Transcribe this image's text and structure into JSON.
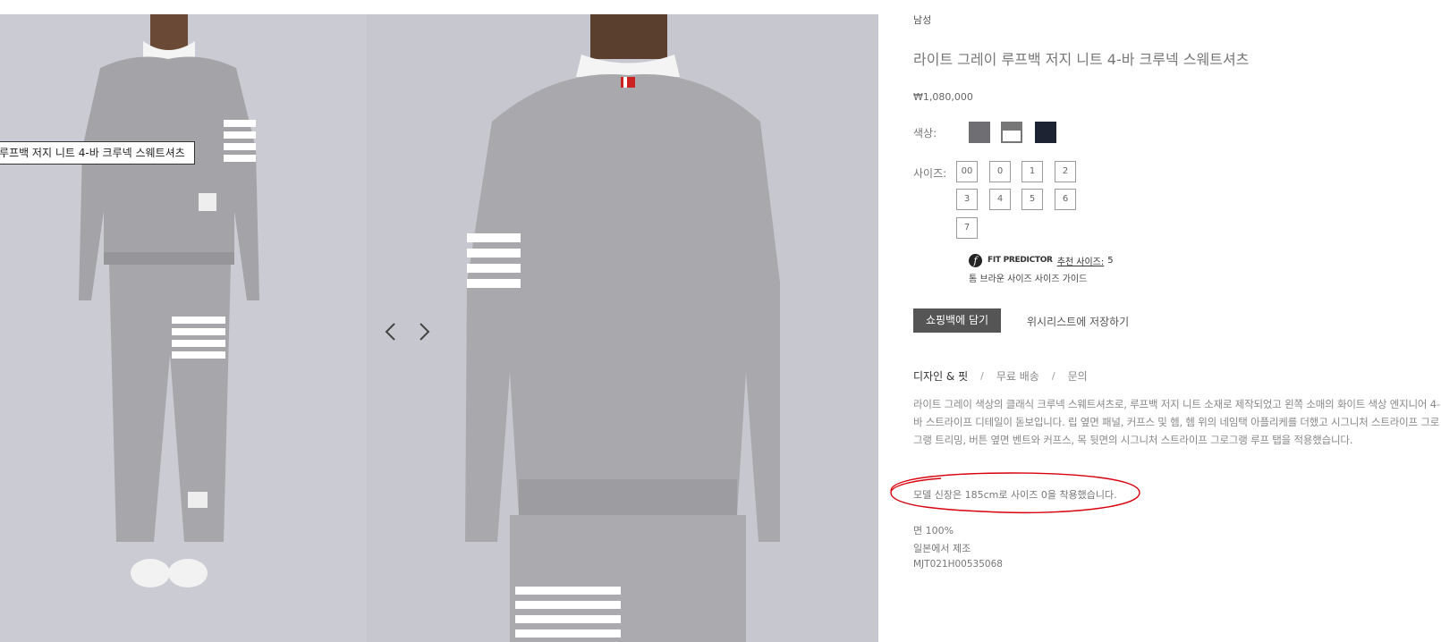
{
  "gallery": {
    "tooltip": "루프백 저지 니트 4-바 크루넥 스웨트셔츠",
    "prev_arrow": "chevron-left-icon",
    "next_arrow": "chevron-right-icon"
  },
  "product": {
    "gender": "남성",
    "title": "라이트 그레이 루프백 저지 니트 4-바 크루넥 스웨트셔츠",
    "price": "₩1,080,000",
    "color_label": "색상:",
    "colors": [
      {
        "name": "medium-grey",
        "hex": "#6f6f73"
      },
      {
        "name": "light-grey",
        "hex": "#777777"
      },
      {
        "name": "navy",
        "hex": "#1d2333"
      }
    ],
    "size_label": "사이즈:",
    "sizes": [
      "00",
      "0",
      "1",
      "2",
      "3",
      "4",
      "5",
      "6",
      "7"
    ],
    "fit_predictor": {
      "brand": "FIT PREDICTOR",
      "link_text": "추천 사이즈:",
      "value": "5"
    },
    "size_guide": "톰 브라운 사이즈 사이즈 가이드",
    "add_to_bag": "쇼핑백에 담기",
    "wishlist": "위시리스트에 저장하기",
    "tabs": [
      "디자인 & 핏",
      "무료 배송",
      "문의"
    ],
    "tab_separator": "/",
    "description": "라이트 그레이 색상의 클래식 크루넥 스웨트셔츠로, 루프백 저지 니트 소재로 제작되었고 왼쪽 소매의 화이트 색상 엔지니어 4-바 스트라이프 디테일이 돋보입니다. 립 옆면 패널, 커프스 및 헴, 헴 위의 네임택 아플리케를 더했고 시그니처 스트라이프 그로그랭 트리밍, 버튼 옆면 벤트와 커프스, 목 뒷면의 시그니처 스트라이프 그로그랭 루프 탭을 적용했습니다.",
    "model_note": "모델 신장은 185cm로 사이즈 0을 착용했습니다.",
    "details": [
      "면 100%",
      "일본에서 제조",
      "MJT021H00535068"
    ]
  },
  "colors": {
    "annotation": "#d8000c",
    "button_bg": "#555555",
    "gallery_bg": "#c9c9d1"
  }
}
